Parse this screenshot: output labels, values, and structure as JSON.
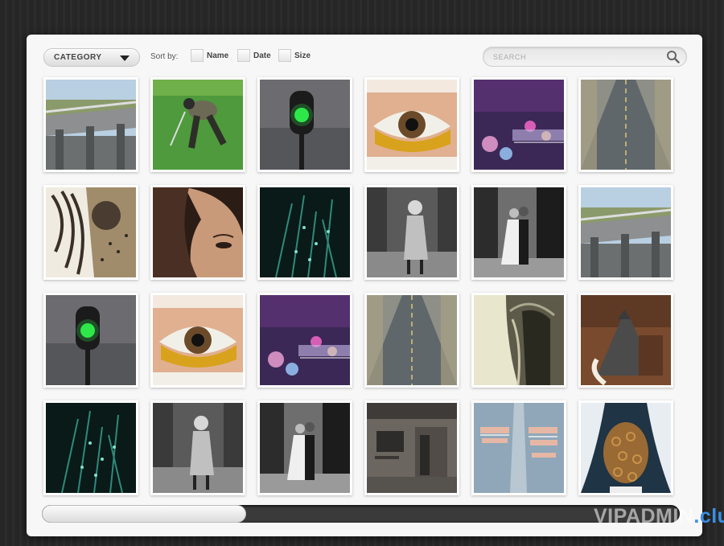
{
  "toolbar": {
    "category_label": "CATEGORY",
    "sort_by_label": "Sort by:",
    "sort_options": [
      "Name",
      "Date",
      "Size"
    ],
    "search_placeholder": "SEARCH"
  },
  "gallery": {
    "rows": [
      [
        "bridge",
        "golfer",
        "traffic-light",
        "eye",
        "city-night",
        "road"
      ],
      [
        "dreadlocks",
        "woman-face",
        "grass-night",
        "girl-forest",
        "couple-alley",
        "bridge"
      ],
      [
        "traffic-light",
        "eye",
        "city-night",
        "road",
        "hooded-figure",
        "bride-door"
      ],
      [
        "grass-night",
        "girl-forest",
        "couple-alley",
        "old-building",
        "torn-jeans",
        "curly-hair"
      ]
    ]
  },
  "scrollbar": {
    "position_fraction": 0.0,
    "visible_fraction": 0.32
  },
  "watermark": {
    "brand": "VIPADMIN",
    "domain": ".club"
  },
  "colors": {
    "accent_green": "#2ee84a",
    "panel_bg": "#f7f7f7",
    "track": "#3a3a3a"
  }
}
